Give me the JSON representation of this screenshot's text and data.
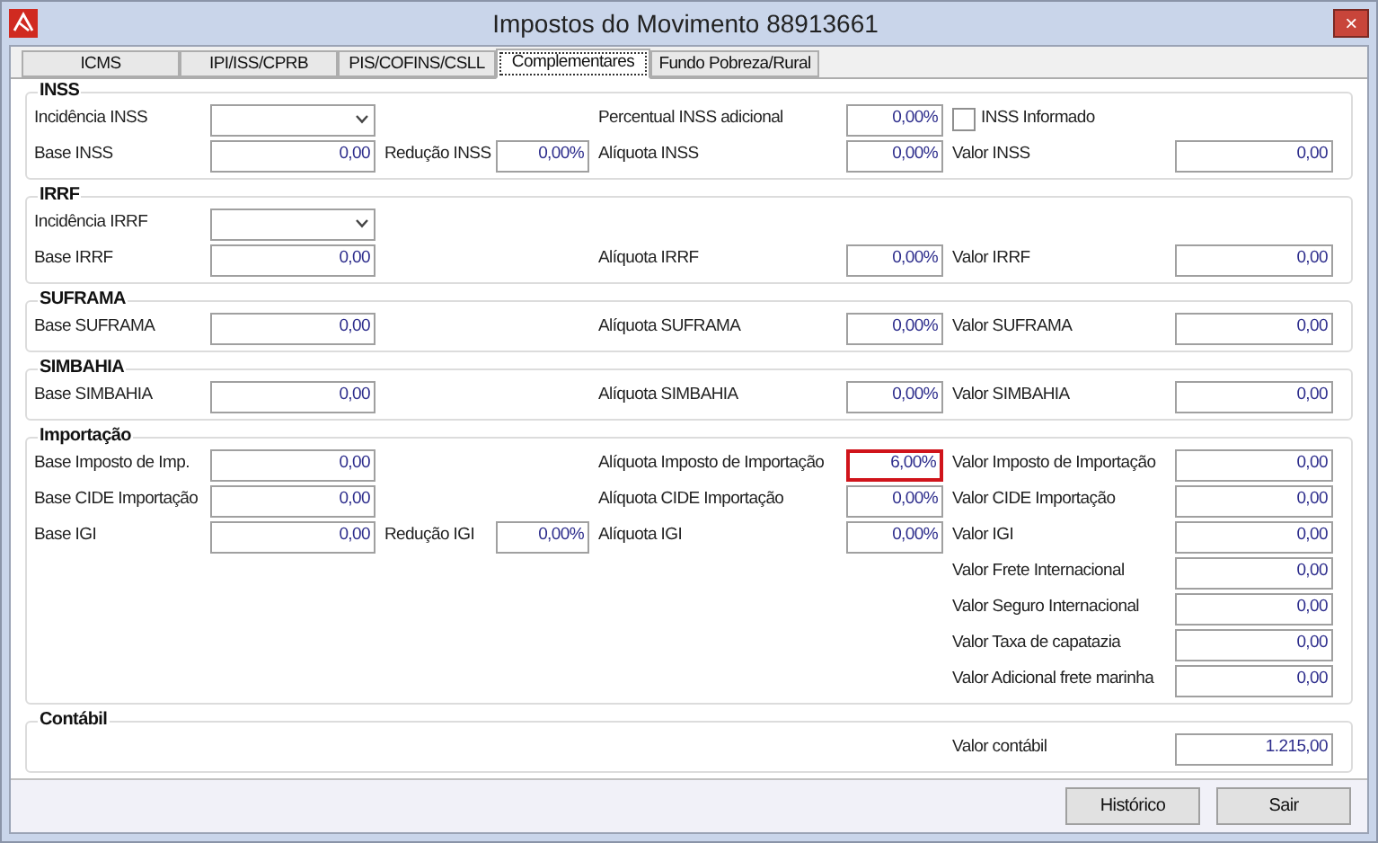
{
  "window": {
    "title": "Impostos do Movimento 88913661",
    "close": "×"
  },
  "tabs": [
    {
      "label": "ICMS",
      "selected": false
    },
    {
      "label": "IPI/ISS/CPRB",
      "selected": false
    },
    {
      "label": "PIS/COFINS/CSLL",
      "selected": false
    },
    {
      "label": "Complementares",
      "selected": true
    },
    {
      "label": "Fundo Pobreza/Rural",
      "selected": false
    }
  ],
  "groups": [
    {
      "title": "INSS",
      "rows": [
        [
          {
            "label": "Incidência INSS",
            "kind": "select"
          },
          null,
          {
            "label": "Percentual INSS adicional",
            "kind": "number",
            "value": "0,00%"
          },
          {
            "label": "INSS Informado",
            "kind": "checkbox",
            "checked": false
          }
        ],
        [
          {
            "label": "Base INSS",
            "kind": "number",
            "value": "0,00"
          },
          {
            "label": "Redução INSS",
            "kind": "number",
            "value": "0,00%"
          },
          {
            "label": "Alíquota INSS",
            "kind": "number",
            "value": "0,00%"
          },
          {
            "label": "Valor INSS",
            "kind": "number",
            "value": "0,00"
          }
        ]
      ]
    },
    {
      "title": "IRRF",
      "rows": [
        [
          {
            "label": "Incidência IRRF",
            "kind": "select"
          },
          null,
          null,
          null
        ],
        [
          {
            "label": "Base IRRF",
            "kind": "number",
            "value": "0,00"
          },
          null,
          {
            "label": "Alíquota IRRF",
            "kind": "number",
            "value": "0,00%"
          },
          {
            "label": "Valor IRRF",
            "kind": "number",
            "value": "0,00"
          }
        ]
      ]
    },
    {
      "title": "SUFRAMA",
      "rows": [
        [
          {
            "label": "Base SUFRAMA",
            "kind": "number",
            "value": "0,00"
          },
          null,
          {
            "label": "Alíquota SUFRAMA",
            "kind": "number",
            "value": "0,00%"
          },
          {
            "label": "Valor SUFRAMA",
            "kind": "number",
            "value": "0,00"
          }
        ]
      ]
    },
    {
      "title": "SIMBAHIA",
      "rows": [
        [
          {
            "label": "Base SIMBAHIA",
            "kind": "number",
            "value": "0,00"
          },
          null,
          {
            "label": "Alíquota SIMBAHIA",
            "kind": "number",
            "value": "0,00%"
          },
          {
            "label": "Valor SIMBAHIA",
            "kind": "number",
            "value": "0,00"
          }
        ]
      ]
    },
    {
      "title": "Importação",
      "rows": [
        [
          {
            "label": "Base Imposto de Imp.",
            "kind": "number",
            "value": "0,00"
          },
          null,
          {
            "label": "Alíquota Imposto de Importação",
            "kind": "number",
            "value": "6,00%",
            "highlighted": true
          },
          {
            "label": "Valor Imposto de Importação",
            "kind": "number",
            "value": "0,00"
          }
        ],
        [
          {
            "label": "Base CIDE Importação",
            "kind": "number",
            "value": "0,00"
          },
          null,
          {
            "label": "Alíquota CIDE Importação",
            "kind": "number",
            "value": "0,00%"
          },
          {
            "label": "Valor CIDE Importação",
            "kind": "number",
            "value": "0,00"
          }
        ],
        [
          {
            "label": "Base IGI",
            "kind": "number",
            "value": "0,00"
          },
          {
            "label": "Redução IGI",
            "kind": "number",
            "value": "0,00%"
          },
          {
            "label": "Alíquota IGI",
            "kind": "number",
            "value": "0,00%"
          },
          {
            "label": "Valor IGI",
            "kind": "number",
            "value": "0,00"
          }
        ],
        [
          null,
          null,
          null,
          {
            "label": "Valor Frete Internacional",
            "kind": "number",
            "value": "0,00"
          }
        ],
        [
          null,
          null,
          null,
          {
            "label": "Valor Seguro Internacional",
            "kind": "number",
            "value": "0,00"
          }
        ],
        [
          null,
          null,
          null,
          {
            "label": "Valor Taxa de capatazia",
            "kind": "number",
            "value": "0,00"
          }
        ],
        [
          null,
          null,
          null,
          {
            "label": "Valor Adicional frete marinha",
            "kind": "number",
            "value": "0,00"
          }
        ]
      ]
    },
    {
      "title": "Contábil",
      "rows": [
        [
          null,
          null,
          null,
          {
            "label": "Valor contábil",
            "kind": "number",
            "value": "1.215,00"
          }
        ]
      ]
    }
  ],
  "buttons": [
    "Histórico",
    "Sair"
  ]
}
